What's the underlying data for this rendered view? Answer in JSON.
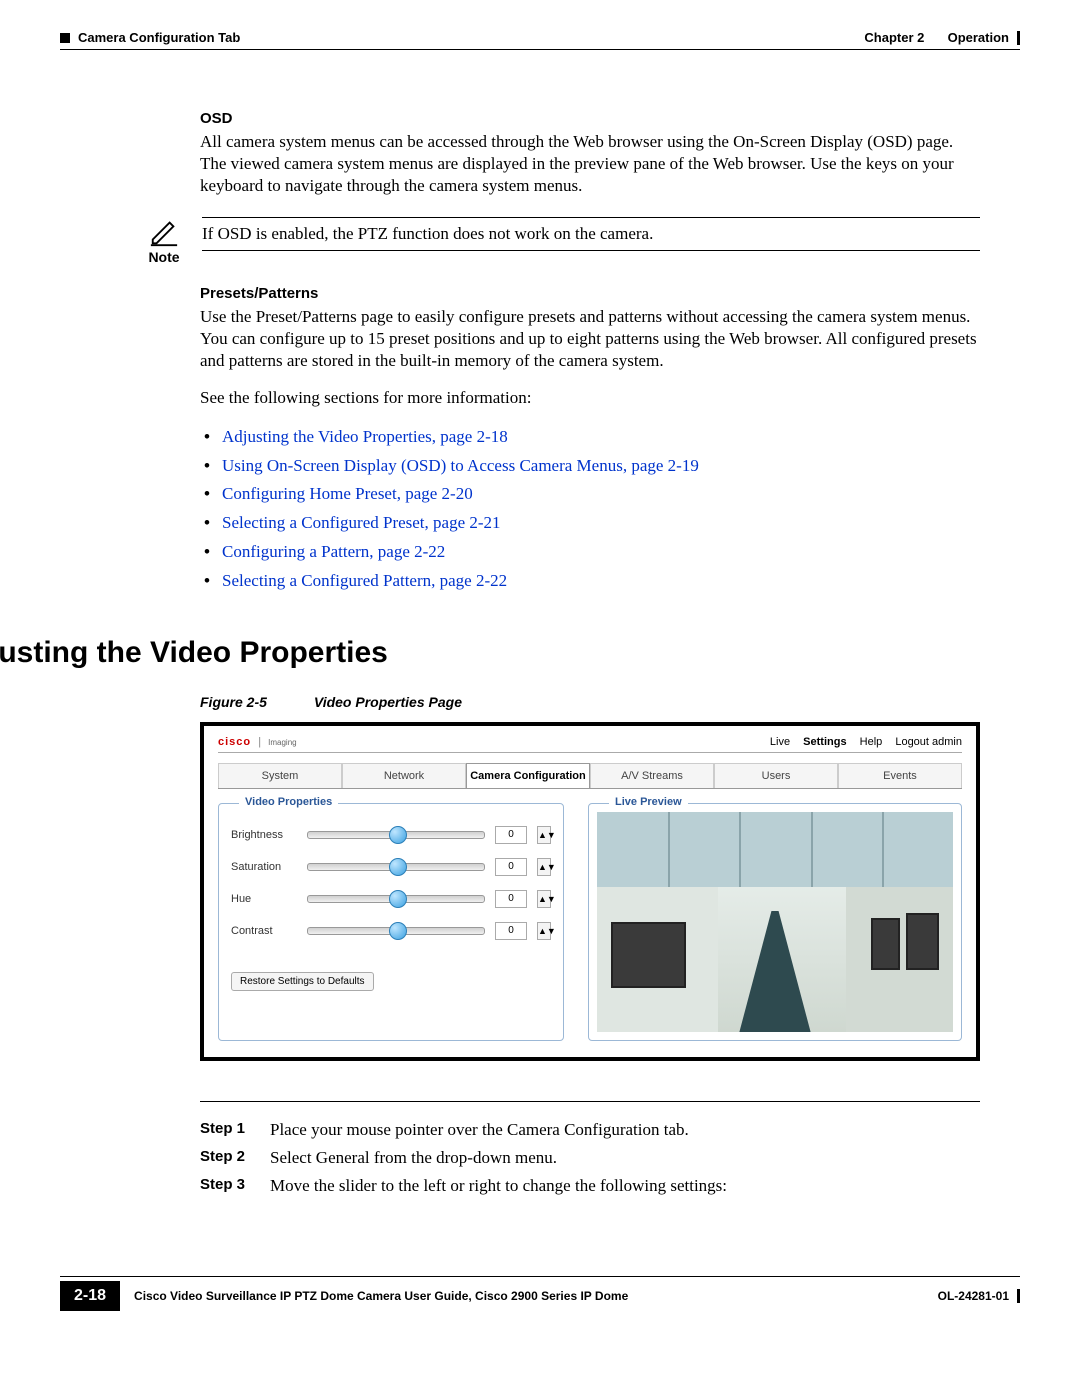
{
  "header": {
    "chapter": "Chapter 2",
    "section": "Operation",
    "breadcrumb": "Camera Configuration Tab"
  },
  "osd": {
    "heading": "OSD",
    "para": "All camera system menus can be accessed through the Web browser using the On-Screen Display (OSD) page. The viewed camera system menus are displayed in the preview pane of the Web browser. Use the keys on your keyboard to navigate through the camera system menus."
  },
  "note": {
    "label": "Note",
    "text": "If OSD is enabled, the PTZ function does not work on the camera."
  },
  "presets": {
    "heading": "Presets/Patterns",
    "para": "Use the Preset/Patterns page to easily configure presets and patterns without accessing the camera system menus. You can configure up to 15 preset positions and up to eight patterns using the Web browser. All configured presets and patterns are stored in the built-in memory of the camera system."
  },
  "see": "See the following sections for more information:",
  "links": [
    "Adjusting the Video Properties, page 2-18",
    "Using On-Screen Display (OSD) to Access Camera Menus, page 2-19",
    "Configuring Home Preset, page 2-20",
    "Selecting a Configured Preset, page 2-21",
    "Configuring a Pattern, page 2-22",
    "Selecting a Configured Pattern, page 2-22"
  ],
  "h1": "Adjusting the Video Properties",
  "figure": {
    "num": "Figure 2-5",
    "title": "Video Properties Page"
  },
  "ui": {
    "brand_line": "cisco",
    "brand_sub": "Imaging",
    "topnav": {
      "live": "Live",
      "settings": "Settings",
      "help": "Help",
      "logout": "Logout admin"
    },
    "tabs": [
      "System",
      "Network",
      "Camera Configuration",
      "A/V Streams",
      "Users",
      "Events"
    ],
    "active_tab": 2,
    "vp_title": "Video Properties",
    "props": [
      {
        "label": "Brightness",
        "value": "0"
      },
      {
        "label": "Saturation",
        "value": "0"
      },
      {
        "label": "Hue",
        "value": "0"
      },
      {
        "label": "Contrast",
        "value": "0"
      }
    ],
    "restore": "Restore Settings to Defaults",
    "lp_title": "Live Preview"
  },
  "steps": [
    {
      "label": "Step 1",
      "text": "Place your mouse pointer over the Camera Configuration tab."
    },
    {
      "label": "Step 2",
      "text": "Select General from the drop-down menu."
    },
    {
      "label": "Step 3",
      "text": "Move the slider to the left or right to change the following settings:"
    }
  ],
  "footer": {
    "title": "Cisco Video Surveillance IP PTZ Dome Camera User Guide, Cisco 2900 Series IP Dome",
    "page": "2-18",
    "doc": "OL-24281-01"
  }
}
